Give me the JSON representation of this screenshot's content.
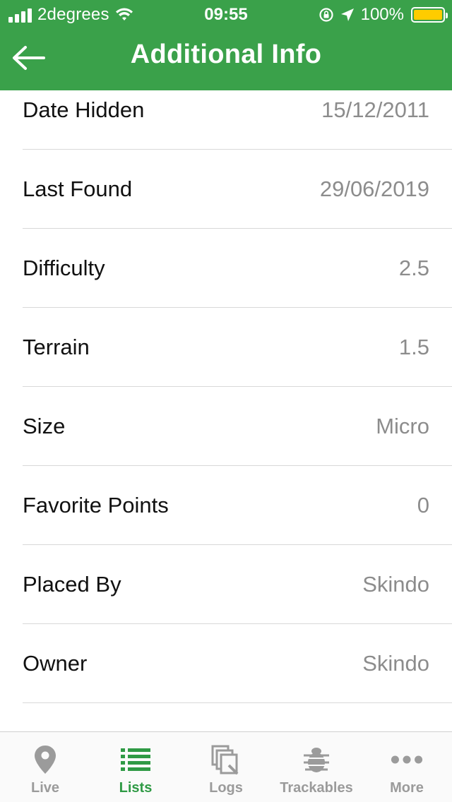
{
  "status_bar": {
    "carrier": "2degrees",
    "time": "09:55",
    "battery": "100%"
  },
  "header": {
    "title": "Additional Info",
    "back_icon": "arrow-left-icon"
  },
  "rows": [
    {
      "label": "Date Hidden",
      "value": "15/12/2011"
    },
    {
      "label": "Last Found",
      "value": "29/06/2019"
    },
    {
      "label": "Difficulty",
      "value": "2.5"
    },
    {
      "label": "Terrain",
      "value": "1.5"
    },
    {
      "label": "Size",
      "value": "Micro"
    },
    {
      "label": "Favorite Points",
      "value": "0"
    },
    {
      "label": "Placed By",
      "value": "Skindo"
    },
    {
      "label": "Owner",
      "value": "Skindo"
    }
  ],
  "tabs": [
    {
      "label": "Live",
      "icon": "map-pin-icon",
      "active": false
    },
    {
      "label": "Lists",
      "icon": "list-icon",
      "active": true
    },
    {
      "label": "Logs",
      "icon": "logs-icon",
      "active": false
    },
    {
      "label": "Trackables",
      "icon": "bug-icon",
      "active": false
    },
    {
      "label": "More",
      "icon": "more-dots-icon",
      "active": false
    }
  ],
  "colors": {
    "header_bg": "#3aa14a",
    "active_tab": "#2f9a45",
    "inactive_tab": "#9b9b9b",
    "value_text": "#8c8c8c"
  }
}
